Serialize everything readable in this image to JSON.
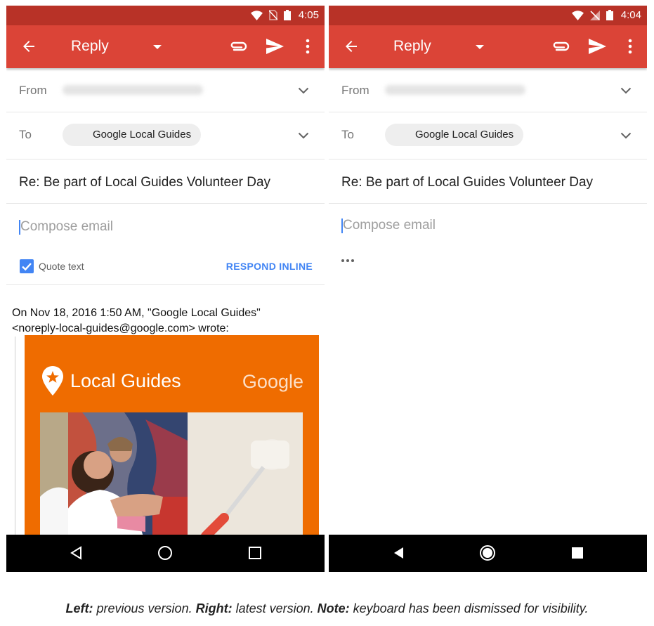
{
  "left": {
    "status_time": "4:05",
    "app_bar": {
      "title": "Reply"
    },
    "fields": {
      "from_label": "From",
      "to_label": "To",
      "to_chip": "Google Local Guides",
      "subject": "Re: Be part of Local Guides Volunteer Day",
      "compose_placeholder": "Compose email"
    },
    "quote": {
      "checkbox_label": "Quote text",
      "checked": true,
      "respond_inline": "RESPOND INLINE"
    },
    "quoted_message": {
      "header_line1": "On Nov 18, 2016 1:50 AM, \"Google Local Guides\"",
      "header_line2": "<noreply-local-guides@google.com> wrote:",
      "brand": "Local Guides",
      "google": "Google"
    }
  },
  "right": {
    "status_time": "4:04",
    "app_bar": {
      "title": "Reply"
    },
    "fields": {
      "from_label": "From",
      "to_label": "To",
      "to_chip": "Google Local Guides",
      "subject": "Re: Be part of Local Guides Volunteer Day",
      "compose_placeholder": "Compose email"
    }
  },
  "caption": {
    "left_label": "Left:",
    "left_text": " previous version. ",
    "right_label": "Right:",
    "right_text": " latest version. ",
    "note_label": "Note:",
    "note_text": " keyboard has been dismissed for visibility."
  },
  "colors": {
    "status_bar": "#b83227",
    "app_bar": "#db4437",
    "accent_blue": "#4285f4",
    "card_orange": "#ef6c00"
  },
  "icons": {
    "app_bar": [
      "back-arrow-icon",
      "dropdown-arrow-icon",
      "attach-icon",
      "send-icon",
      "more-vert-icon"
    ],
    "status": [
      "wifi-icon",
      "no-sim-icon",
      "battery-icon"
    ],
    "nav": [
      "nav-back-icon",
      "nav-home-icon",
      "nav-recents-icon"
    ],
    "email": [
      "map-pin-icon",
      "ellipsis-icon",
      "chevron-down-icon",
      "checkbox-icon"
    ]
  }
}
